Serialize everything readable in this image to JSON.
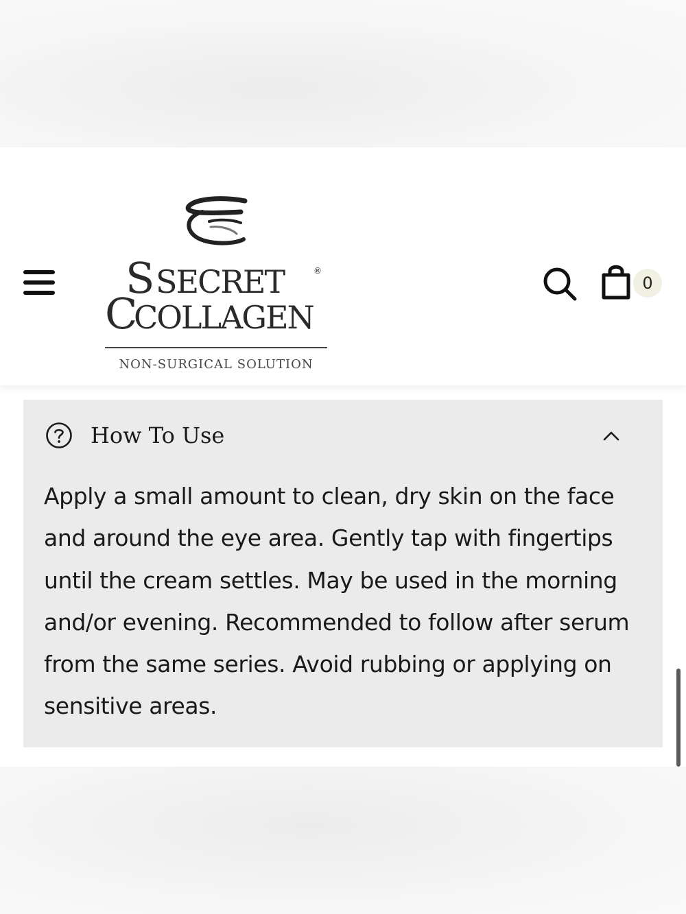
{
  "header": {
    "menu_icon": "hamburger-menu-icon",
    "search_icon": "search-icon",
    "cart_icon": "shopping-bag-icon",
    "cart_count": "0"
  },
  "logo": {
    "brand_line1": "SECRET",
    "brand_line2": "COLLAGEN",
    "tagline": "NON-SURGICAL SOLUTION",
    "registered_mark": "®"
  },
  "accordion": {
    "icon": "question-circle-icon",
    "title": "How To Use",
    "expanded": true,
    "toggle_icon": "chevron-up-icon",
    "body": "Apply a small amount to clean, dry skin on the face and around the eye area. Gently tap with fingertips until the cream settles. May be used in the morning and/or evening. Recommended to follow after serum from the same series. Avoid rubbing or applying on sensitive areas."
  },
  "colors": {
    "accordion_background": "#ebebeb",
    "cart_badge_background": "#f1f1e3",
    "text": "#1a1a1a"
  }
}
